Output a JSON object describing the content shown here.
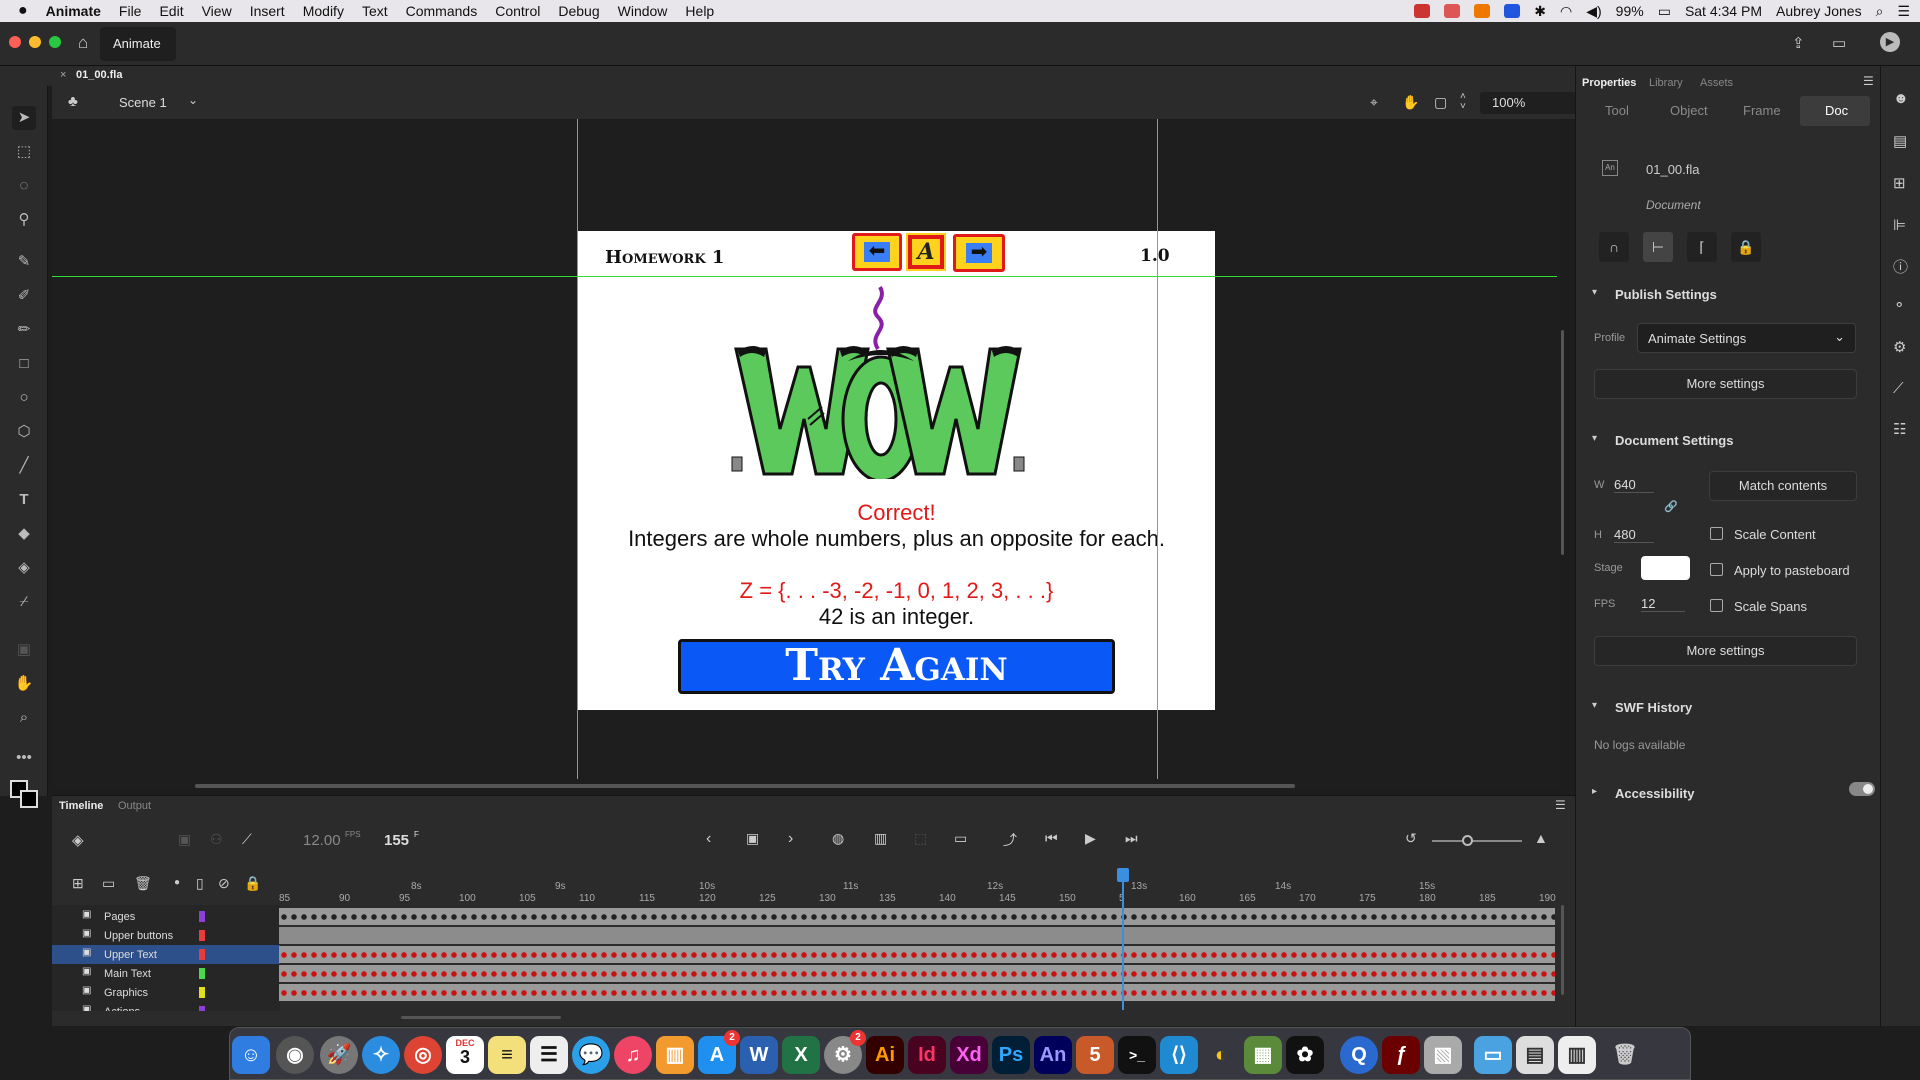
{
  "menubar": {
    "apple": "",
    "items": [
      "Animate",
      "File",
      "Edit",
      "View",
      "Insert",
      "Modify",
      "Text",
      "Commands",
      "Control",
      "Debug",
      "Window",
      "Help"
    ],
    "battery": "99%",
    "clock": "Sat 4:34 PM",
    "user": "Aubrey Jones"
  },
  "titlebar": {
    "home_label": "Animate"
  },
  "doc_tab": {
    "name": "01_00.fla"
  },
  "scene": {
    "name": "Scene 1",
    "zoom": "100%"
  },
  "stage": {
    "header_title": "Homework 1",
    "version": "1.0",
    "nav_logo": "A",
    "wow": "WOW",
    "correct": "Correct!",
    "line1": "Integers are whole numbers, plus an opposite for each.",
    "set": "Z = {. . . -3, -2, -1, 0, 1, 2, 3, . . .}",
    "line3": "42 is an integer.",
    "try_again": "Try Again",
    "colors": {
      "red": "#e11919",
      "blue": "#0a58f5",
      "green": "#5bc95b",
      "yellow": "#ffd21e"
    }
  },
  "properties": {
    "tabs": [
      "Properties",
      "Library",
      "Assets"
    ],
    "subtabs": [
      "Tool",
      "Object",
      "Frame",
      "Doc"
    ],
    "doc_name": "01_00.fla",
    "doc_type": "Document",
    "publish": {
      "header": "Publish Settings",
      "profile_label": "Profile",
      "profile_value": "Animate Settings",
      "more": "More settings"
    },
    "document": {
      "header": "Document Settings",
      "w_label": "W",
      "w": "640",
      "h_label": "H",
      "h": "480",
      "match": "Match contents",
      "scale_content": "Scale Content",
      "stage_label": "Stage",
      "apply_pasteboard": "Apply to pasteboard",
      "fps_label": "FPS",
      "fps": "12",
      "scale_spans": "Scale Spans",
      "more": "More settings"
    },
    "swf": {
      "header": "SWF History",
      "empty": "No logs available"
    },
    "accessibility": {
      "header": "Accessibility"
    }
  },
  "timeline": {
    "tabs": [
      "Timeline",
      "Output"
    ],
    "fps": "12.00",
    "fps_unit": "FPS",
    "frame": "155",
    "frame_unit": "F",
    "seconds": [
      "8s",
      "9s",
      "10s",
      "11s",
      "12s",
      "13s",
      "14s",
      "15s"
    ],
    "frame_ticks": [
      "85",
      "90",
      "95",
      "100",
      "105",
      "110",
      "115",
      "120",
      "125",
      "130",
      "135",
      "140",
      "145",
      "150",
      "5",
      "160",
      "165",
      "170",
      "175",
      "180",
      "185",
      "190"
    ],
    "layers": [
      {
        "name": "Pages",
        "color": "#8b3fd9"
      },
      {
        "name": "Upper buttons",
        "color": "#e83b3b"
      },
      {
        "name": "Upper Text",
        "color": "#e83b3b"
      },
      {
        "name": "Main Text",
        "color": "#4ad94a"
      },
      {
        "name": "Graphics",
        "color": "#e0e020"
      },
      {
        "name": "Actions",
        "color": "#8b3fd9"
      }
    ]
  },
  "dock": {
    "labels": [
      "Ai",
      "Id",
      "Xd",
      "Ps",
      "An"
    ],
    "calendar_month": "DEC",
    "calendar_day": "3",
    "badge_appstore": "2",
    "badge_prefs": "2"
  }
}
